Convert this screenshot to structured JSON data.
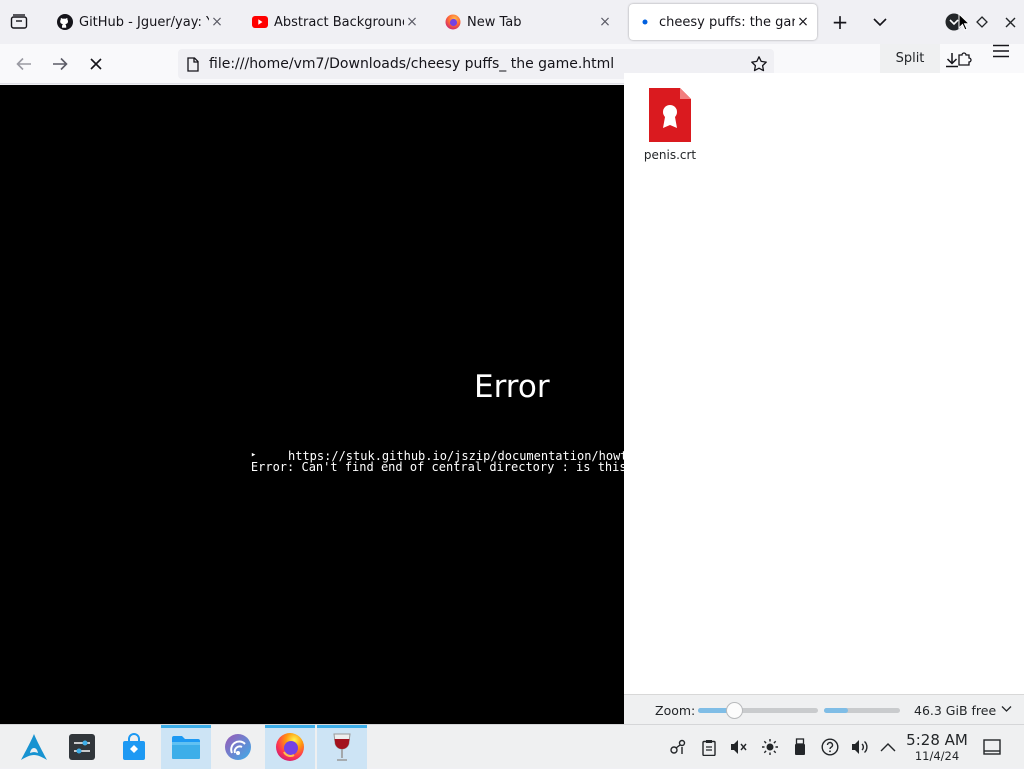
{
  "browser": {
    "tabs": [
      {
        "title": "GitHub - Jguer/yay: Yet another Yogurt",
        "favicon": "github-icon",
        "active": false
      },
      {
        "title": "Abstract Background",
        "favicon": "youtube-icon",
        "active": false
      },
      {
        "title": "New Tab",
        "favicon": "firefox-icon",
        "active": false
      },
      {
        "title": "cheesy puffs: the game",
        "favicon": "loading-dot-icon",
        "active": true
      }
    ],
    "close_symbol": "×",
    "new_tab_symbol": "+",
    "url": "file:///home/vm7/Downloads/cheesy puffs_ the game.html"
  },
  "page": {
    "error_title": "Error",
    "error_marker": "▸",
    "error_message": "Error: Can't find end of central directory : is this a zip file ? If it is, see",
    "error_link": "https://stuk.github.io/jszip/documentation/howto/read_zip.html"
  },
  "file_manager": {
    "split_label": "Split",
    "files": [
      {
        "name": "penis.crt",
        "icon": "certificate-file-icon"
      }
    ],
    "zoom_label": "Zoom:",
    "zoom_level": 0.3,
    "disk_used_fraction": 0.32,
    "free_space": "46.3 GiB free"
  },
  "taskbar": {
    "apps": [
      "arch-launcher-icon",
      "system-settings-icon",
      "discover-store-icon",
      "file-manager-icon",
      "kde-connect-icon",
      "firefox-icon",
      "wine-icon"
    ],
    "active_apps": [
      "file-manager-icon",
      "firefox-icon",
      "wine-icon"
    ],
    "clock_time": "5:28 AM",
    "clock_date": "11/4/24"
  },
  "colors": {
    "accent": "#3daee9",
    "youtube_red": "#ff0000",
    "certificate_red": "#da1a1f",
    "page_background": "#000000"
  }
}
